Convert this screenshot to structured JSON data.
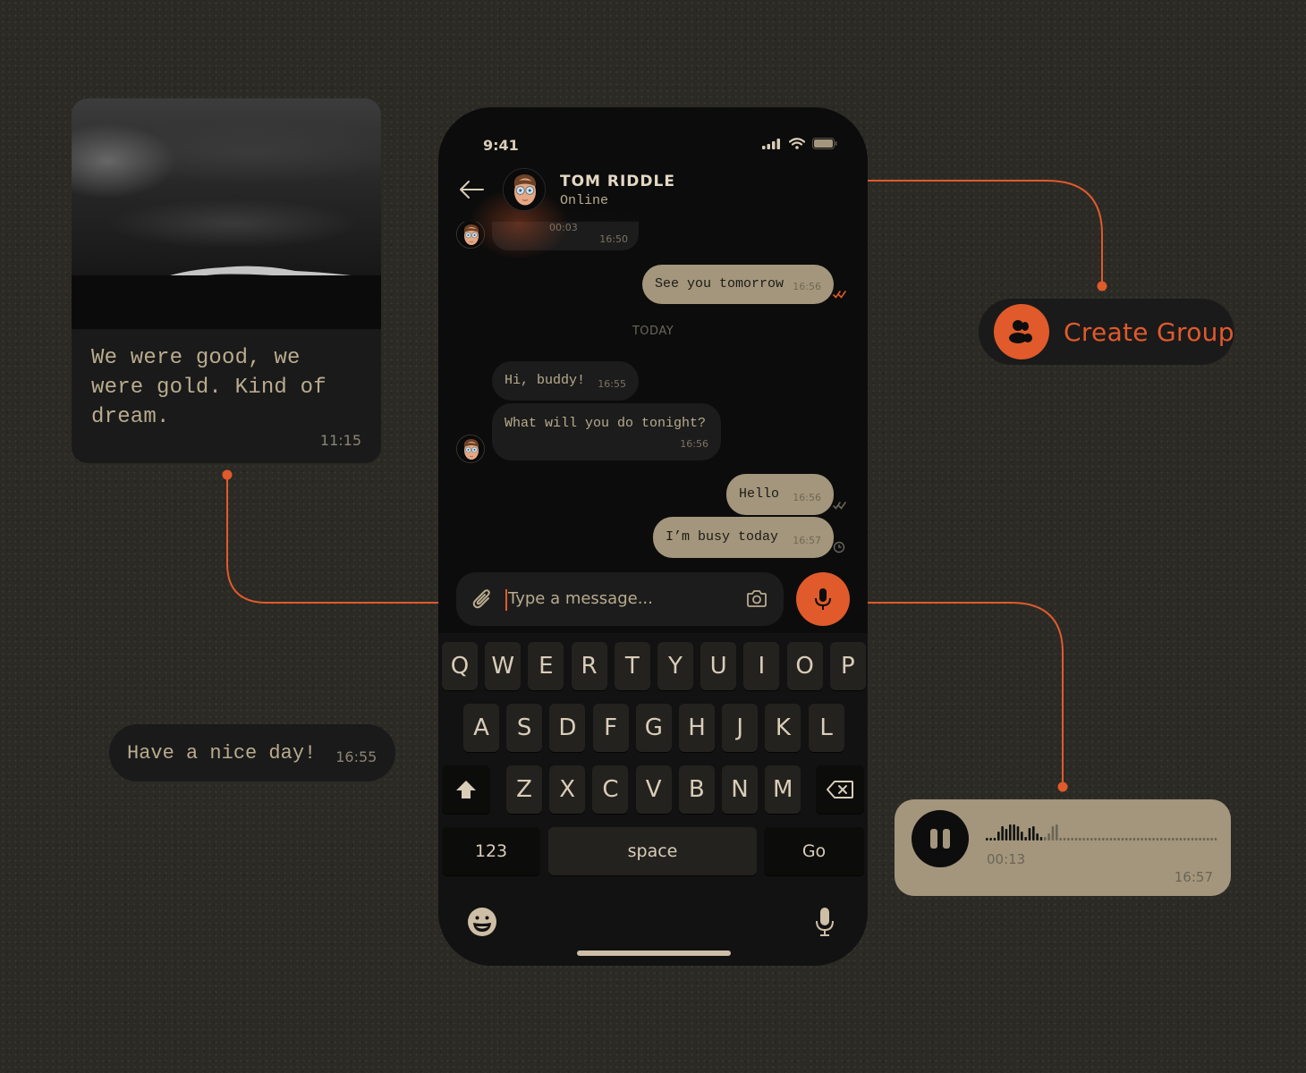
{
  "colors": {
    "accent": "#e05a2b",
    "bubble_outgoing": "#a3967c",
    "bubble_incoming": "#1c1c1c",
    "background": "#2b2a25",
    "text_light": "#d9cdb8"
  },
  "image_card": {
    "image_alt": "black-and-white aerial photo of ocean waves",
    "caption": "We were good, we were gold. Kind of dream.",
    "time": "11:15"
  },
  "nice_day_bubble": {
    "text": "Have a nice day!",
    "time": "16:55"
  },
  "create_group": {
    "icon": "group-icon",
    "label": "Create Group"
  },
  "voice_message": {
    "icon": "pause-icon",
    "duration": "00:13",
    "time": "16:57",
    "played_fraction": 0.25
  },
  "phone": {
    "status_bar": {
      "time": "9:41",
      "icons": [
        "signal-icon",
        "wifi-icon",
        "battery-icon"
      ]
    },
    "header": {
      "back_icon": "arrow-left-icon",
      "contact_name": "TOM RIDDLE",
      "contact_status": "Online"
    },
    "messages": [
      {
        "direction": "in",
        "type": "voice",
        "duration": "00:03",
        "time": "16:50"
      },
      {
        "direction": "out",
        "text": "See you tomorrow",
        "time": "16:56",
        "status": "read"
      },
      {
        "type": "divider",
        "text": "TODAY"
      },
      {
        "direction": "in",
        "text": "Hi, buddy!",
        "time": "16:55"
      },
      {
        "direction": "in",
        "text": "What will you do tonight?",
        "time": "16:56"
      },
      {
        "direction": "out",
        "text": "Hello",
        "time": "16:56",
        "status": "delivered"
      },
      {
        "direction": "out",
        "text": "I’m busy today",
        "time": "16:57",
        "status": "pending"
      }
    ],
    "composer": {
      "attach_icon": "paperclip-icon",
      "placeholder": "Type a message...",
      "camera_icon": "camera-icon",
      "mic_icon": "microphone-icon"
    },
    "keyboard": {
      "row1": [
        "Q",
        "W",
        "E",
        "R",
        "T",
        "Y",
        "U",
        "I",
        "O",
        "P"
      ],
      "row2": [
        "A",
        "S",
        "D",
        "F",
        "G",
        "H",
        "J",
        "K",
        "L"
      ],
      "row3": [
        "Z",
        "X",
        "C",
        "V",
        "B",
        "N",
        "M"
      ],
      "shift_icon": "shift-icon",
      "backspace_icon": "backspace-icon",
      "numbers_label": "123",
      "space_label": "space",
      "go_label": "Go",
      "emoji_icon": "emoji-icon",
      "dictation_icon": "microphone-icon"
    }
  }
}
